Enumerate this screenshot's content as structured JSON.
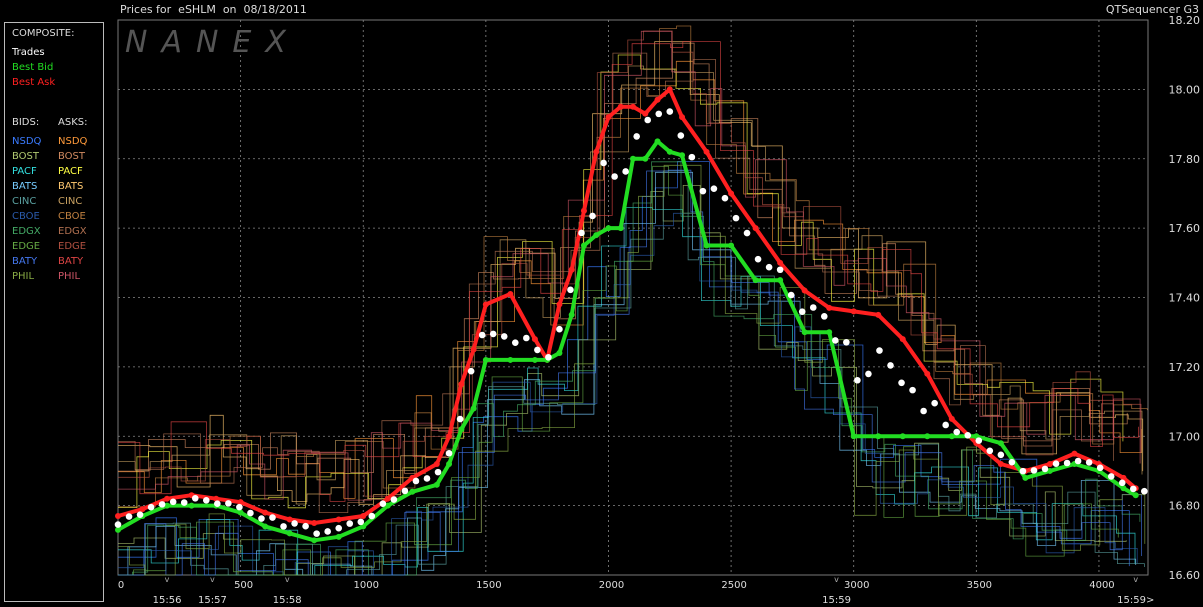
{
  "header": {
    "title": "Prices for  eSHLM  on  08/18/2011",
    "app": "QTSequencer G3"
  },
  "watermark": "NANEX",
  "legend": {
    "composite_title": "COMPOSITE:",
    "composite": [
      {
        "label": "Trades",
        "color": "#ffffff"
      },
      {
        "label": "Best Bid",
        "color": "#22dd22"
      },
      {
        "label": "Best Ask",
        "color": "#ff2020"
      }
    ],
    "bids_title": "BIDS:",
    "asks_title": "ASKS:",
    "exchanges": [
      {
        "bid": "NSDQ",
        "bid_color": "#3a7bff",
        "ask": "NSDQ",
        "ask_color": "#ff9a3a"
      },
      {
        "bid": "BOST",
        "bid_color": "#b0c870",
        "ask": "BOST",
        "ask_color": "#d08a60"
      },
      {
        "bid": "PACF",
        "bid_color": "#33e0e0",
        "ask": "PACF",
        "ask_color": "#ffff44"
      },
      {
        "bid": "BATS",
        "bid_color": "#77ccff",
        "ask": "BATS",
        "ask_color": "#ffc870"
      },
      {
        "bid": "CINC",
        "bid_color": "#5aa0a0",
        "ask": "CINC",
        "ask_color": "#c8a060"
      },
      {
        "bid": "CBOE",
        "bid_color": "#2a5aaa",
        "ask": "CBOE",
        "ask_color": "#c08040"
      },
      {
        "bid": "EDGX",
        "bid_color": "#44aa66",
        "ask": "EDGX",
        "ask_color": "#b07050"
      },
      {
        "bid": "EDGE",
        "bid_color": "#66aa44",
        "ask": "EDGE",
        "ask_color": "#b05040"
      },
      {
        "bid": "BATY",
        "bid_color": "#4477ee",
        "ask": "BATY",
        "ask_color": "#dd4444"
      },
      {
        "bid": "PHIL",
        "bid_color": "#88aa44",
        "ask": "PHIL",
        "ask_color": "#cc5566"
      }
    ]
  },
  "chart_data": {
    "type": "line",
    "xlim": [
      0,
      4200
    ],
    "ylim": [
      16.6,
      18.2
    ],
    "x_ticks": [
      0,
      500,
      1000,
      1500,
      2000,
      2500,
      3000,
      3500,
      4000
    ],
    "y_ticks": [
      16.6,
      16.8,
      17.0,
      17.2,
      17.4,
      17.6,
      17.8,
      18.0,
      18.2
    ],
    "y_tick_labels": [
      "16.60",
      "16.80",
      "17.00",
      "17.20",
      "17.40",
      "17.60",
      "17.80",
      "18.00",
      "18.20"
    ],
    "time_labels": [
      {
        "x": 200,
        "label": "15:56"
      },
      {
        "x": 385,
        "label": "15:57"
      },
      {
        "x": 690,
        "label": "15:58"
      },
      {
        "x": 2930,
        "label": "15:59"
      },
      {
        "x": 4150,
        "label": "15:59>"
      }
    ],
    "series": [
      {
        "name": "Best Ask",
        "color": "#ff2020",
        "x": [
          0,
          100,
          200,
          300,
          400,
          500,
          600,
          700,
          800,
          900,
          1000,
          1100,
          1200,
          1300,
          1350,
          1400,
          1450,
          1500,
          1600,
          1700,
          1750,
          1800,
          1850,
          1900,
          1950,
          2000,
          2050,
          2100,
          2150,
          2200,
          2250,
          2300,
          2400,
          2500,
          2600,
          2700,
          2800,
          2900,
          3000,
          3100,
          3200,
          3300,
          3400,
          3500,
          3600,
          3700,
          3800,
          3900,
          4000,
          4100,
          4150
        ],
        "y": [
          16.77,
          16.79,
          16.82,
          16.83,
          16.82,
          16.81,
          16.78,
          16.76,
          16.75,
          16.76,
          16.77,
          16.82,
          16.88,
          16.92,
          17.0,
          17.15,
          17.25,
          17.38,
          17.41,
          17.28,
          17.22,
          17.38,
          17.48,
          17.65,
          17.82,
          17.92,
          17.95,
          17.95,
          17.93,
          17.97,
          18.0,
          17.92,
          17.82,
          17.7,
          17.6,
          17.5,
          17.42,
          17.37,
          17.36,
          17.35,
          17.28,
          17.18,
          17.05,
          16.98,
          16.92,
          16.9,
          16.92,
          16.95,
          16.92,
          16.88,
          16.85
        ]
      },
      {
        "name": "Best Bid",
        "color": "#22dd22",
        "x": [
          0,
          100,
          200,
          300,
          400,
          500,
          600,
          700,
          800,
          900,
          1000,
          1100,
          1200,
          1300,
          1350,
          1400,
          1450,
          1500,
          1600,
          1700,
          1750,
          1800,
          1850,
          1900,
          1950,
          2000,
          2050,
          2100,
          2150,
          2200,
          2250,
          2300,
          2400,
          2500,
          2600,
          2700,
          2800,
          2900,
          3000,
          3100,
          3200,
          3300,
          3400,
          3500,
          3600,
          3700,
          3800,
          3900,
          4000,
          4100,
          4150
        ],
        "y": [
          16.73,
          16.77,
          16.8,
          16.8,
          16.8,
          16.78,
          16.74,
          16.72,
          16.7,
          16.71,
          16.74,
          16.8,
          16.84,
          16.86,
          16.92,
          17.02,
          17.08,
          17.22,
          17.22,
          17.22,
          17.22,
          17.24,
          17.35,
          17.55,
          17.58,
          17.6,
          17.6,
          17.8,
          17.8,
          17.85,
          17.82,
          17.81,
          17.55,
          17.55,
          17.45,
          17.45,
          17.3,
          17.3,
          17.0,
          17.0,
          17.0,
          17.0,
          17.0,
          17.0,
          16.98,
          16.88,
          16.9,
          16.92,
          16.9,
          16.85,
          16.83
        ]
      }
    ]
  }
}
